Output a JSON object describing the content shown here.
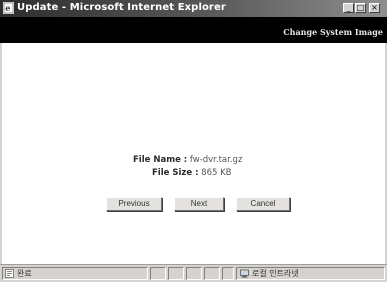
{
  "window": {
    "title": "Update - Microsoft Internet Explorer",
    "minimize": "_",
    "maximize": "□",
    "close": "×"
  },
  "header": {
    "heading": "Change System Image"
  },
  "file": {
    "name_label": "File Name :",
    "name_value": "fw-dvr.tar.gz",
    "size_label": "File Size :",
    "size_value": "865 KB"
  },
  "buttons": {
    "previous": "Previous",
    "next": "Next",
    "cancel": "Cancel"
  },
  "statusbar": {
    "status": "완료",
    "zone": "로컬 인트라넷"
  },
  "colors": {
    "header_bg": "#000000",
    "content_bg": "#ffffff",
    "chrome": "#d6d3ce"
  }
}
